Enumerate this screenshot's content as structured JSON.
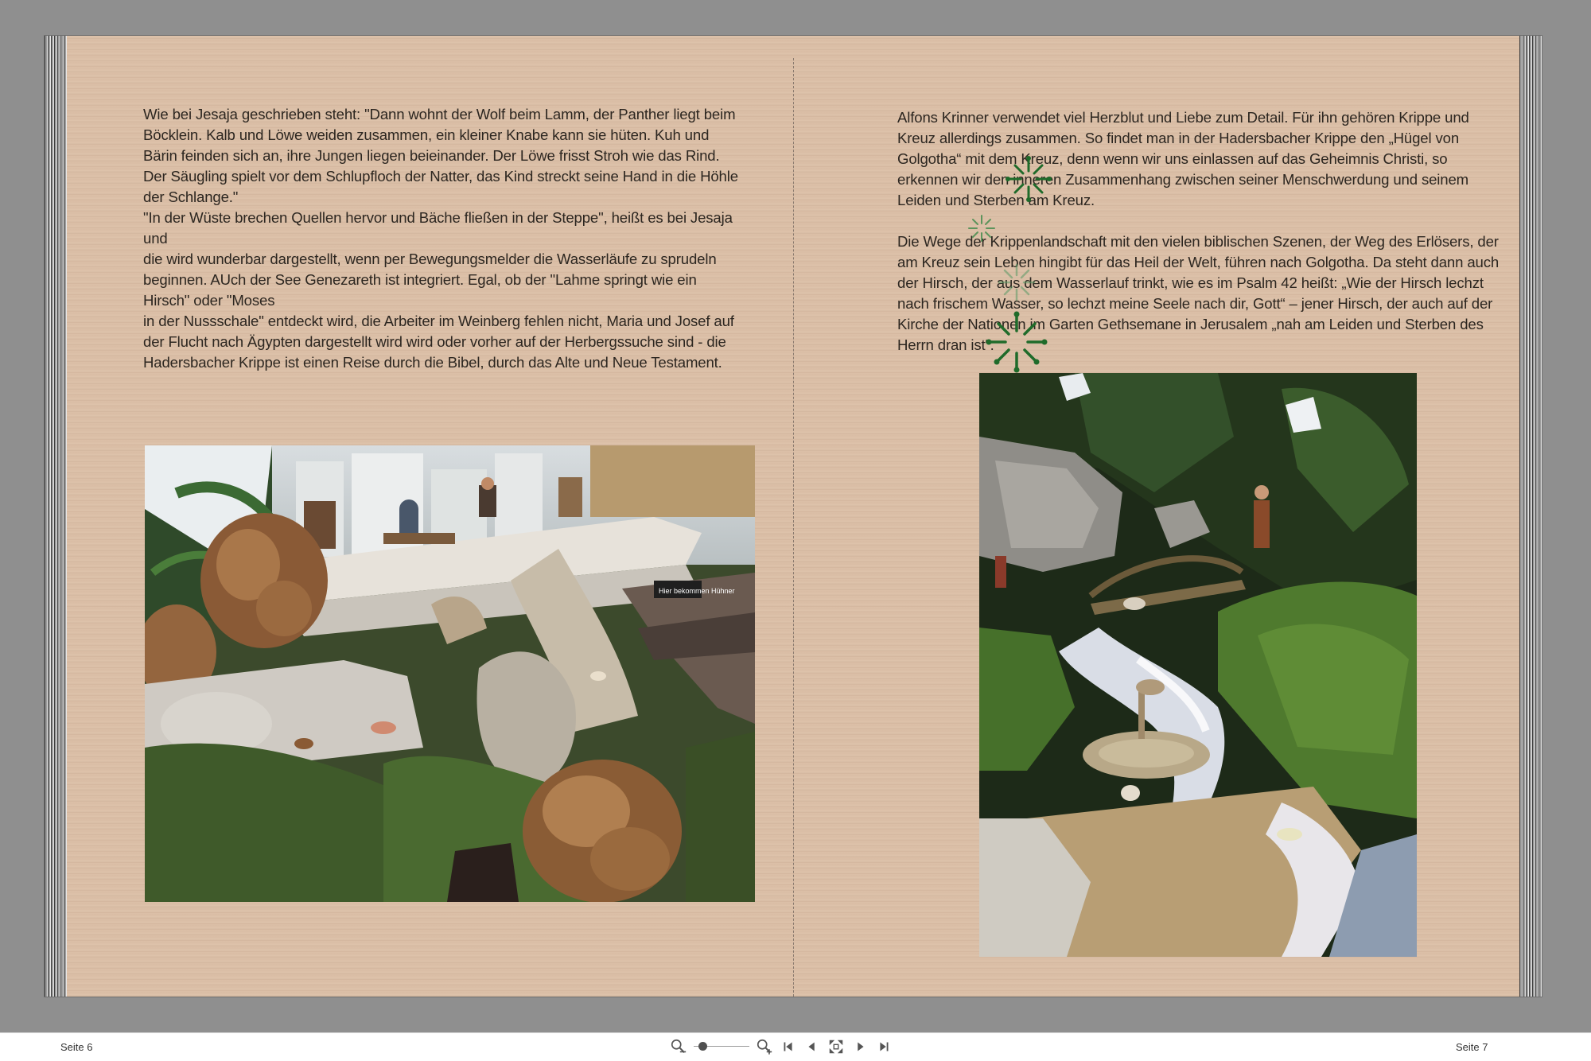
{
  "book": {
    "left_page": {
      "paragraphs": [
        "Wie bei Jesaja geschrieben steht: \"Dann wohnt der Wolf beim Lamm, der Panther liegt beim Böcklein. Kalb und Löwe weiden zusammen, ein kleiner Knabe kann sie hüten. Kuh und Bärin feinden sich an, ihre Jungen liegen beieinander. Der Löwe frisst Stroh wie das Rind. Der Säugling spielt vor dem Schlupfloch der Natter, das Kind streckt seine Hand in die Höhle der Schlange.\"",
        "\"In der Wüste brechen Quellen hervor und Bäche fließen in der Steppe\", heißt es bei Jesaja und",
        "die wird wunderbar dargestellt, wenn per Bewegungsmelder die Wasserläufe zu sprudeln beginnen. AUch der See Genezareth ist integriert. Egal, ob der \"Lahme springt wie ein Hirsch\" oder \"Moses",
        "in der Nussschale\" entdeckt wird, die Arbeiter im Weinberg fehlen nicht, Maria und Josef auf der Flucht nach Ägypten dargestellt wird wird oder vorher auf der Herbergssuche sind - die Hadersbacher Krippe ist einen Reise durch die Bibel, durch das Alte und Neue Testament."
      ],
      "photo_sign_text": "Hier bekommen Hühner"
    },
    "right_page": {
      "paragraphs": [
        " Alfons Krinner verwendet viel Herzblut und Liebe zum Detail. Für ihn gehören Krippe und Kreuz allerdings zusammen. So findet man in der Hadersbacher Krippe den „Hügel von Golgotha“ mit dem Kreuz, denn wenn wir uns einlassen auf das Geheimnis Christi, so erkennen wir den inneren Zusammenhang zwischen seiner Menschwerdung und seinem Leiden und Sterben am Kreuz.",
        "Die Wege der Krippenlandschaft mit den vielen biblischen Szenen, der Weg des Erlösers, der am Kreuz sein Leben hingibt für das Heil der Welt, führen nach Golgotha. Da steht dann auch der Hirsch, der aus dem Wasserlauf trinkt, wie es im Psalm 42 heißt: „Wie der Hirsch lechzt nach frischem Wasser, so lechzt meine Seele nach dir, Gott“ – jener Hirsch, der auch auf der Kirche der Nationen im Garten Gethsemane in Jerusalem „nah am Leiden und Sterben des Herrn dran ist“."
      ]
    }
  },
  "footer": {
    "left_page_label": "Seite 6",
    "right_page_label": "Seite 7",
    "zoom_level": 0.1,
    "icons": {
      "zoom_out": "zoom-out-icon",
      "zoom_in": "zoom-in-icon",
      "first_page": "first-page-icon",
      "prev_page": "previous-page-icon",
      "fit": "fit-page-icon",
      "next_page": "next-page-icon",
      "last_page": "last-page-icon"
    }
  },
  "colors": {
    "background": "#8f8f8f",
    "paper": "#dcc0a8",
    "text": "#2c2620",
    "decor_green": "#1f6b2a"
  }
}
